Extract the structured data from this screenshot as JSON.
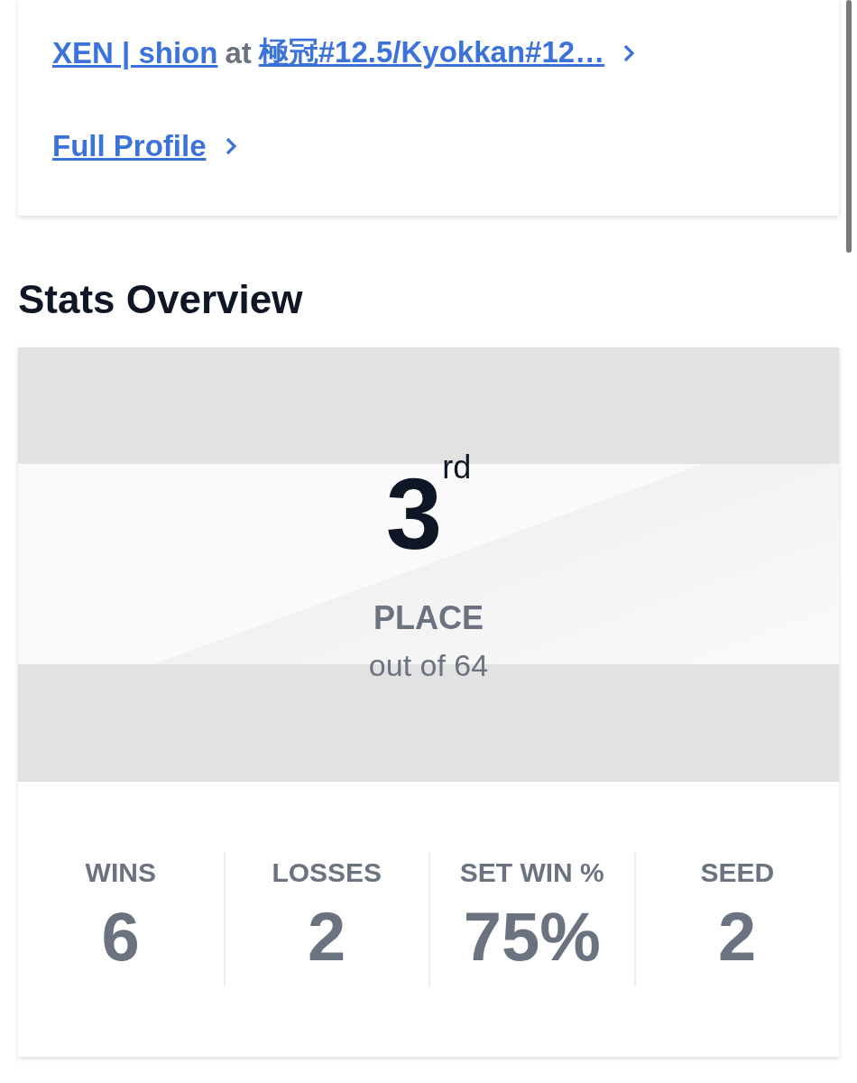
{
  "profile_card": {
    "player_link": "XEN | shion",
    "connector": "at",
    "event_link": "極冠#12.5/Kyokkan#12…",
    "full_profile_link": "Full Profile"
  },
  "stats_overview": {
    "title": "Stats Overview",
    "placement": {
      "rank": "3$^{rd}$",
      "label": "PLACE",
      "out_of": "out of 64"
    },
    "stats": [
      {
        "label": "WINS",
        "value": "6"
      },
      {
        "label": "LOSSES",
        "value": "2"
      },
      {
        "label": "SET WIN %",
        "value": "75%"
      },
      {
        "label": "SEED",
        "value": "2"
      }
    ]
  }
}
